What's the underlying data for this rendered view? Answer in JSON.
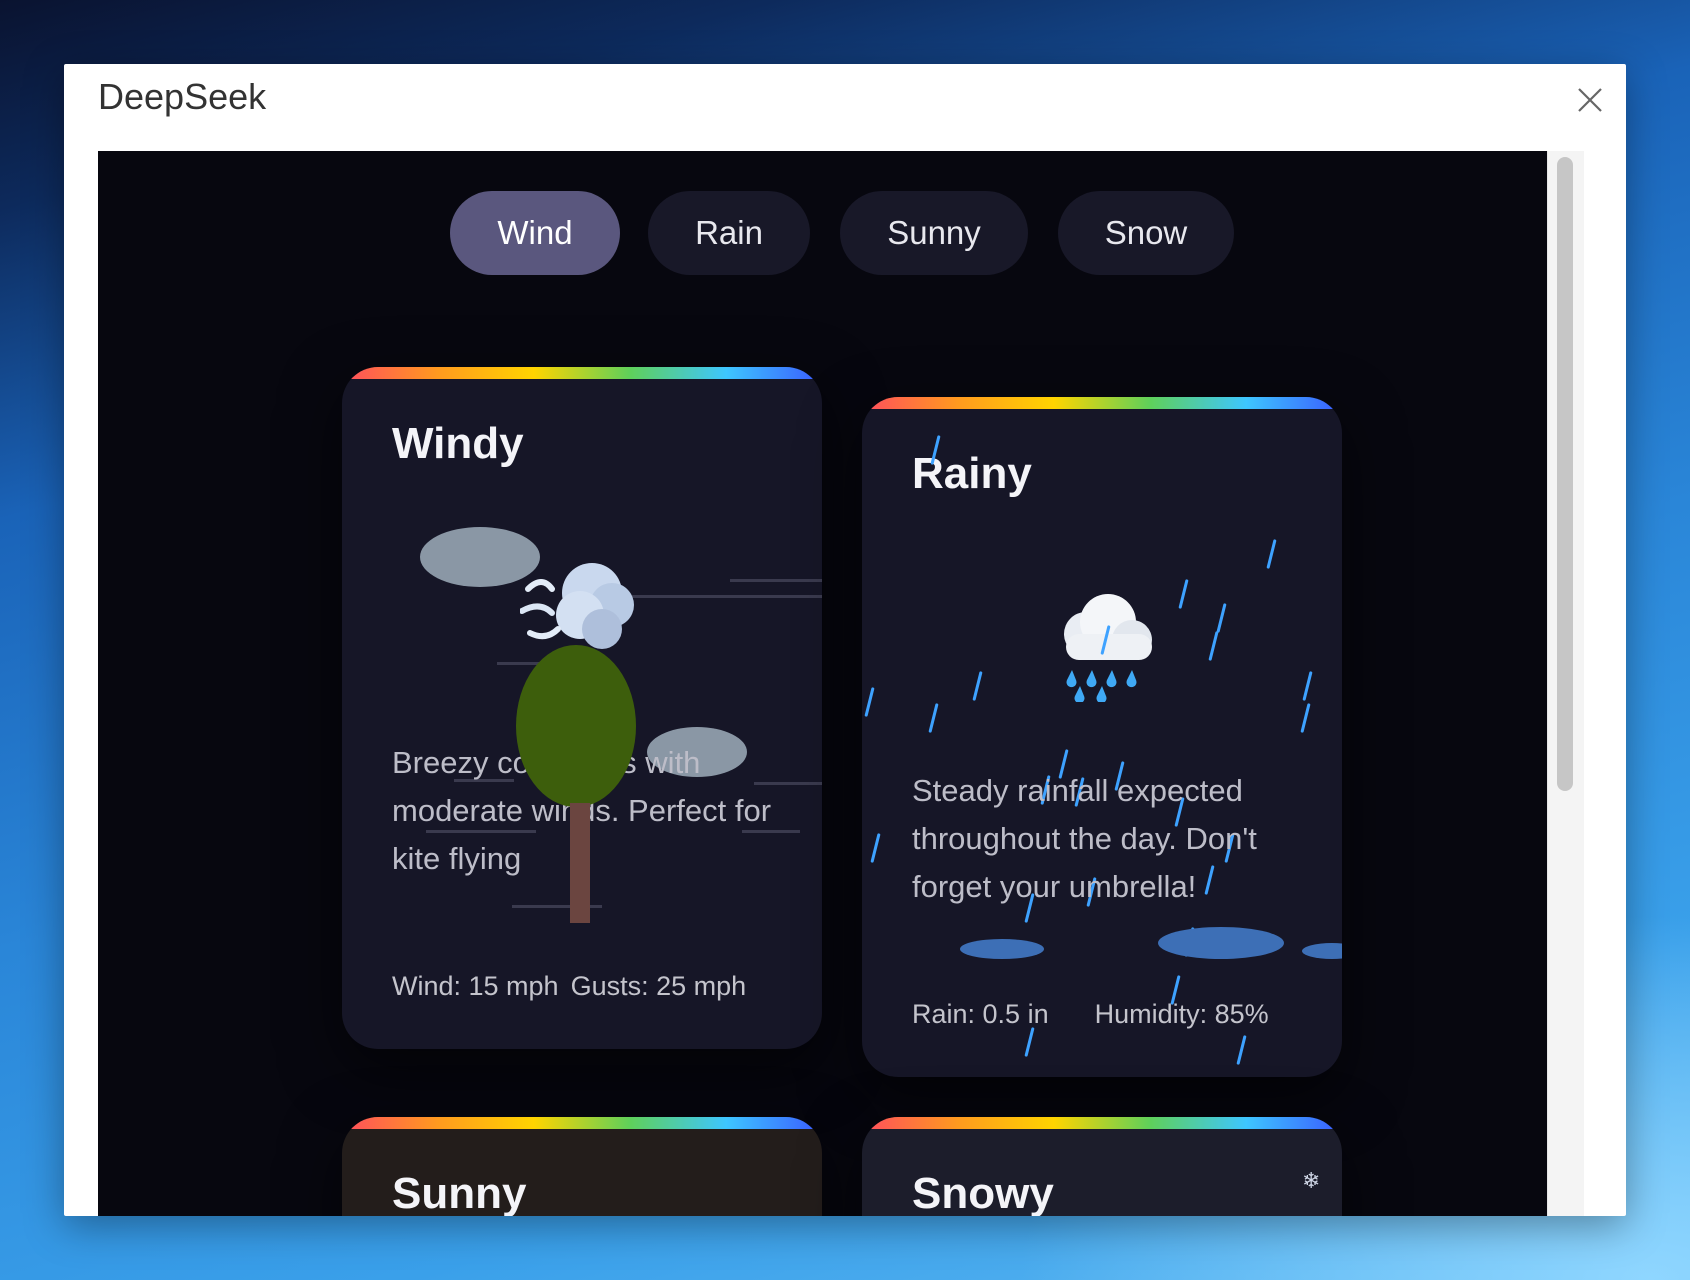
{
  "window": {
    "title": "DeepSeek"
  },
  "tabs": [
    {
      "label": "Wind",
      "active": true
    },
    {
      "label": "Rain",
      "active": false
    },
    {
      "label": "Sunny",
      "active": false
    },
    {
      "label": "Snow",
      "active": false
    }
  ],
  "cards": {
    "windy": {
      "title": "Windy",
      "description": "Breezy conditions with moderate winds. Perfect for kite flying",
      "stat1": "Wind: 15 mph",
      "stat2": "Gusts: 25 mph",
      "icon": "wind-face-icon"
    },
    "rainy": {
      "title": "Rainy",
      "description": "Steady rainfall expected throughout the day. Don't forget your umbrella!",
      "stat1": "Rain: 0.5 in",
      "stat2": "Humidity: 85%",
      "icon": "cloud-with-rain-icon"
    },
    "sunny": {
      "title": "Sunny"
    },
    "snowy": {
      "title": "Snowy",
      "icon": "snowflake-icon"
    }
  },
  "colors": {
    "active_tab": "#5a577e",
    "tab_bg": "#181828",
    "card_bg": "#161627",
    "page_bg": "#07070f",
    "rain": "#3ea2ff",
    "tree_canopy": "#3d5e0c",
    "tree_trunk": "#6b4540"
  }
}
